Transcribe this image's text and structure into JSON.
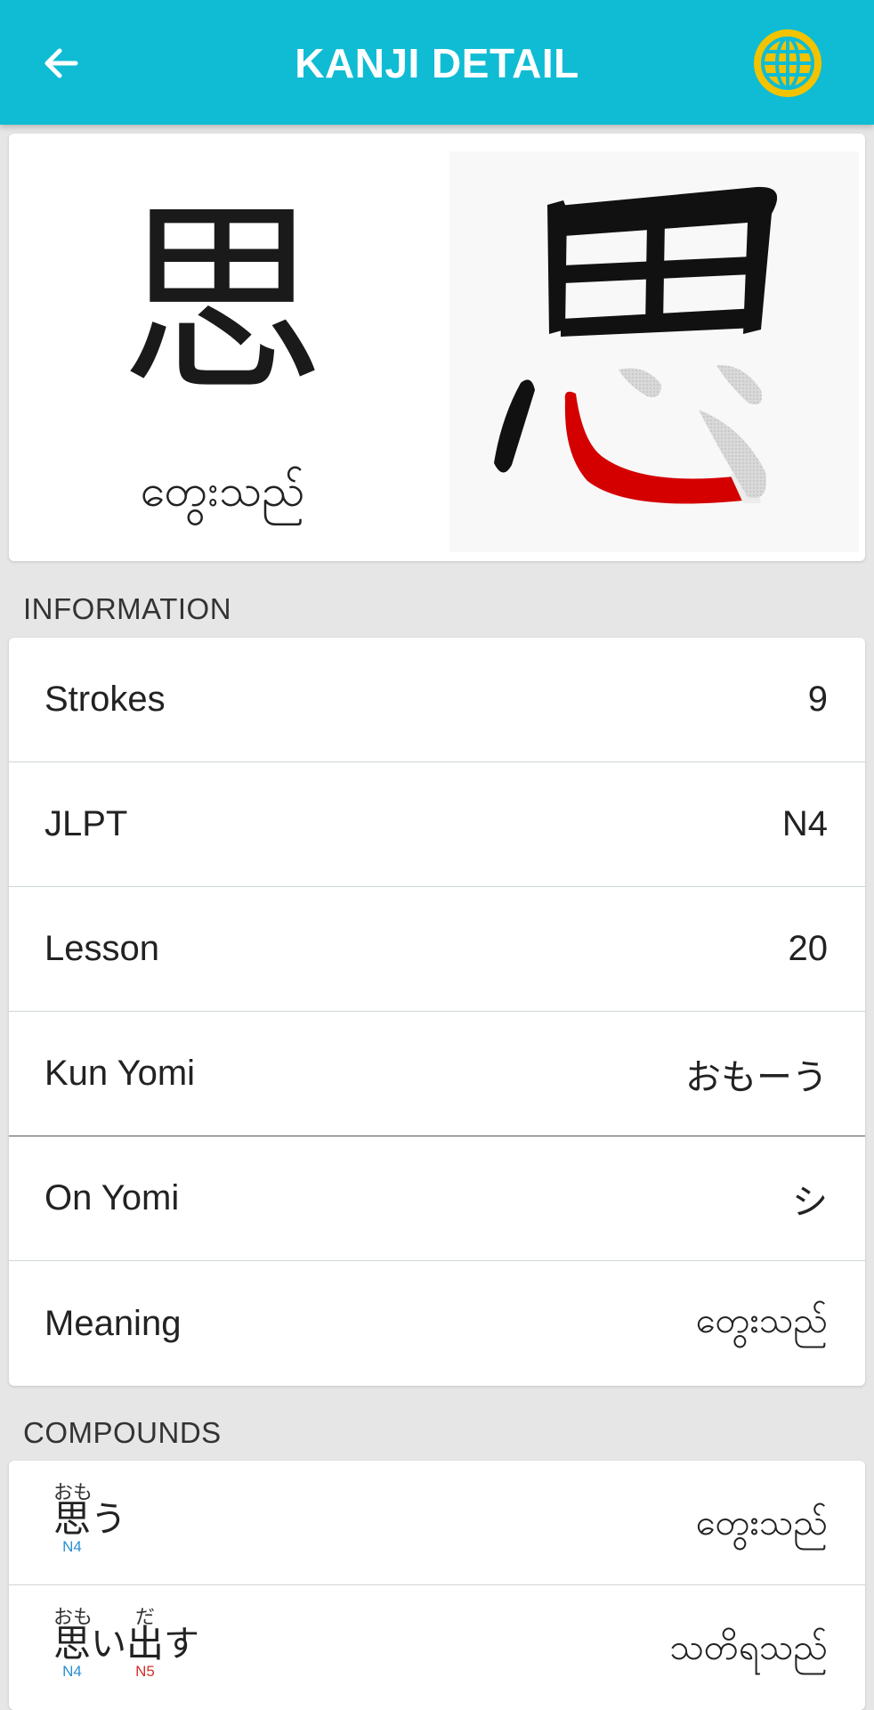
{
  "appbar": {
    "title": "KANJI DETAIL",
    "back_icon": "arrow-left-icon",
    "globe_icon": "globe-icon",
    "color": "#0fbcd4",
    "globe_color": "#f3c300"
  },
  "hero": {
    "kanji": "思",
    "meaning": "တွေးသည်",
    "stroke_icon": "stroke-order-animation"
  },
  "sections": {
    "information": "INFORMATION",
    "compounds": "COMPOUNDS"
  },
  "info": {
    "rows": [
      {
        "label": "Strokes",
        "value": "9"
      },
      {
        "label": "JLPT",
        "value": "N4"
      },
      {
        "label": "Lesson",
        "value": "20"
      },
      {
        "label": "Kun Yomi",
        "value": "おもーう"
      },
      {
        "label": "On Yomi",
        "value": "シ"
      },
      {
        "label": "Meaning",
        "value": "တွေးသည်"
      }
    ]
  },
  "compounds": [
    {
      "kanji1": "思",
      "reading1": "おも",
      "level1": "N4",
      "kana": "う",
      "meaning": "တွေးသည်"
    },
    {
      "kanji1": "思",
      "reading1": "おも",
      "level1": "N4",
      "kana_mid": "い",
      "kanji2": "出",
      "reading2": "だ",
      "level2": "N5",
      "kana_end": "す",
      "meaning": "သတိရသည်"
    }
  ],
  "colors": {
    "level_n4": "#2a8fcf",
    "level_n5": "#d0322c",
    "stroke_active": "#d40000"
  }
}
